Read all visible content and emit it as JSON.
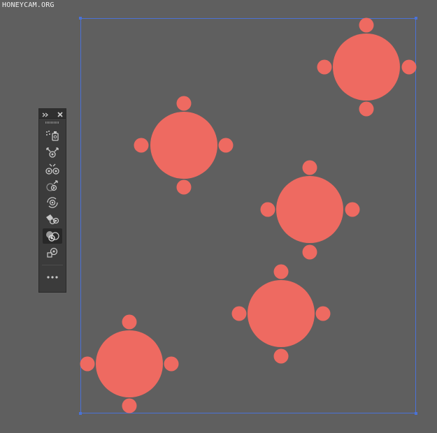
{
  "watermark": "HONEYCAM.ORG",
  "colors": {
    "canvas_bg": "#5f5f5f",
    "artboard_border": "#4b72d6",
    "symbol_fill": "#ee6a61",
    "panel_bg": "#3b3b3b",
    "icon_color": "#c8c8c8"
  },
  "symbols_panel": {
    "header": {
      "collapse_icon": "double-chevron-right-icon",
      "close_icon": "close-x-icon"
    },
    "tools": [
      {
        "name": "symbol-sprayer-tool",
        "icon": "symbol-sprayer-icon",
        "active": false
      },
      {
        "name": "symbol-shifter-tool",
        "icon": "symbol-shifter-icon",
        "active": false
      },
      {
        "name": "symbol-scruncher-tool",
        "icon": "symbol-scruncher-icon",
        "active": false
      },
      {
        "name": "symbol-sizer-tool",
        "icon": "symbol-sizer-icon",
        "active": false
      },
      {
        "name": "symbol-spinner-tool",
        "icon": "symbol-spinner-icon",
        "active": false
      },
      {
        "name": "symbol-stainer-tool",
        "icon": "symbol-stainer-icon",
        "active": false
      },
      {
        "name": "symbol-screener-tool",
        "icon": "symbol-screener-icon",
        "active": true
      },
      {
        "name": "symbol-styler-tool",
        "icon": "symbol-styler-icon",
        "active": false
      }
    ],
    "more_icon": "ellipsis-icon"
  },
  "symbol_instances": 5
}
